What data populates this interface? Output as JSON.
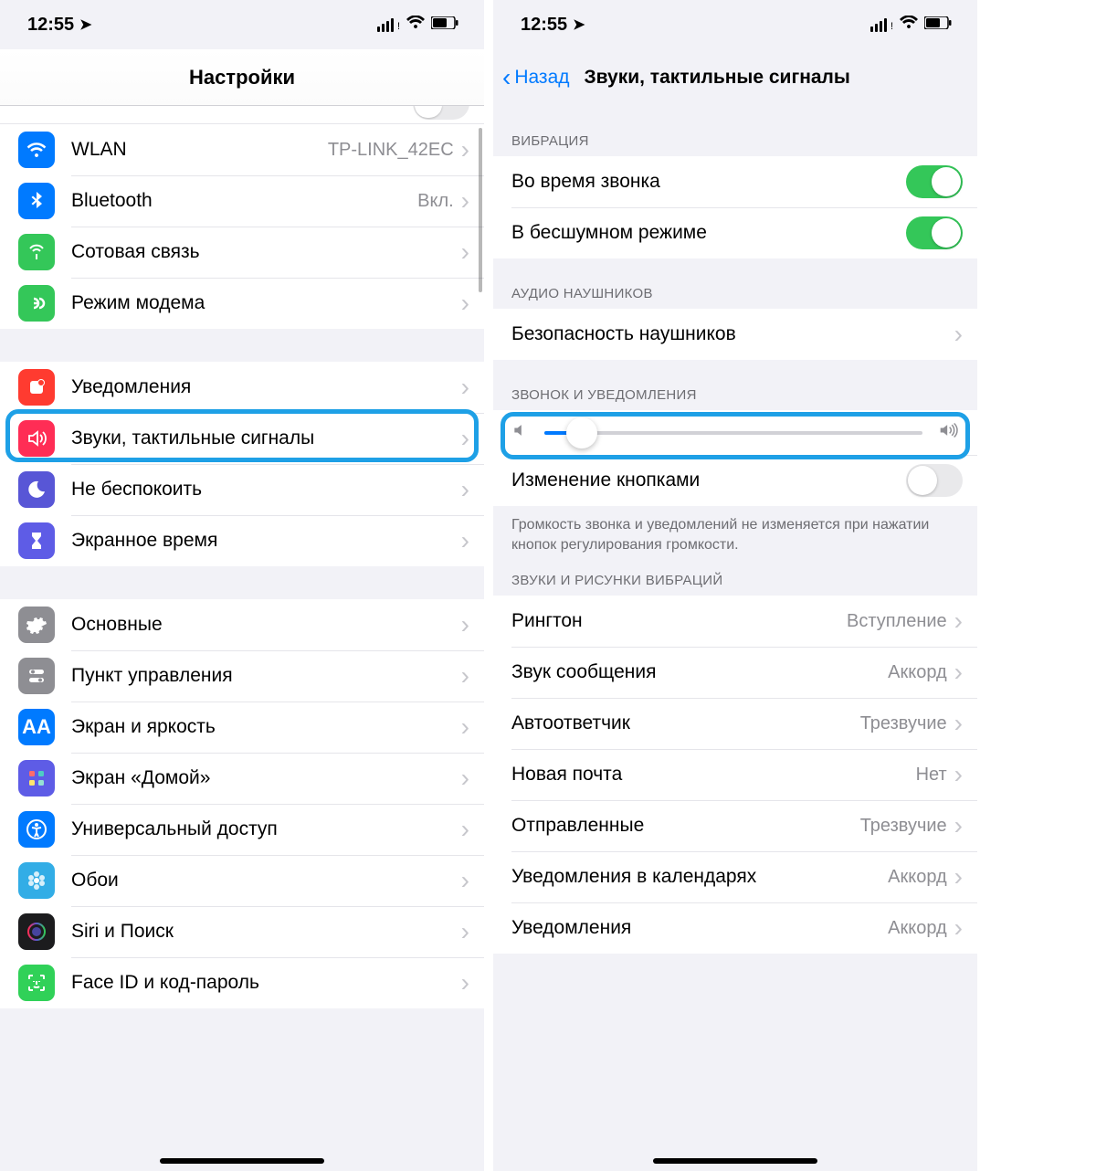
{
  "statusbar": {
    "time": "12:55"
  },
  "left": {
    "title": "Настройки",
    "rows": [
      {
        "id": "wlan",
        "label": "WLAN",
        "value": "TP-LINK_42EC",
        "icon": "wifi-icon",
        "bg": "bg-blue"
      },
      {
        "id": "bluetooth",
        "label": "Bluetooth",
        "value": "Вкл.",
        "icon": "bluetooth-icon",
        "bg": "bg-blue"
      },
      {
        "id": "cellular",
        "label": "Сотовая связь",
        "icon": "antenna-icon",
        "bg": "bg-green"
      },
      {
        "id": "hotspot",
        "label": "Режим модема",
        "icon": "link-icon",
        "bg": "bg-green"
      }
    ],
    "rows2": [
      {
        "id": "notifications",
        "label": "Уведомления",
        "icon": "bell-icon",
        "bg": "bg-red"
      },
      {
        "id": "sounds",
        "label": "Звуки, тактильные сигналы",
        "icon": "speaker-icon",
        "bg": "bg-pink",
        "highlighted": true
      },
      {
        "id": "dnd",
        "label": "Не беспокоить",
        "icon": "moon-icon",
        "bg": "bg-purple"
      },
      {
        "id": "screentime",
        "label": "Экранное время",
        "icon": "hourglass-icon",
        "bg": "bg-indigo"
      }
    ],
    "rows3": [
      {
        "id": "general",
        "label": "Основные",
        "icon": "gear-icon",
        "bg": "bg-gray"
      },
      {
        "id": "control-center",
        "label": "Пункт управления",
        "icon": "switches-icon",
        "bg": "bg-gray"
      },
      {
        "id": "display",
        "label": "Экран и яркость",
        "icon": "text-size-icon",
        "bg": "bg-blue"
      },
      {
        "id": "home",
        "label": "Экран «Домой»",
        "icon": "grid-icon",
        "bg": "bg-indigo"
      },
      {
        "id": "accessibility",
        "label": "Универсальный доступ",
        "icon": "accessibility-icon",
        "bg": "bg-blue"
      },
      {
        "id": "wallpaper",
        "label": "Обои",
        "icon": "flower-icon",
        "bg": "bg-cyan"
      },
      {
        "id": "siri",
        "label": "Siri и Поиск",
        "icon": "siri-icon",
        "bg": "bg-black"
      },
      {
        "id": "faceid",
        "label": "Face ID и код-пароль",
        "icon": "face-icon",
        "bg": "bg-lime"
      }
    ]
  },
  "right": {
    "back_label": "Назад",
    "title": "Звуки, тактильные сигналы",
    "sections": {
      "vibration": {
        "header": "ВИБРАЦИЯ",
        "rows": [
          {
            "id": "vibrate-ring",
            "label": "Во время звонка",
            "toggle": "on"
          },
          {
            "id": "vibrate-silent",
            "label": "В бесшумном режиме",
            "toggle": "on"
          }
        ]
      },
      "headphone": {
        "header": "АУДИО НАУШНИКОВ",
        "rows": [
          {
            "id": "headphone-safety",
            "label": "Безопасность наушников",
            "chevron": true
          }
        ]
      },
      "ringer": {
        "header": "ЗВОНОК И УВЕДОМЛЕНИЯ",
        "slider_percent": 10,
        "change_buttons": {
          "label": "Изменение кнопками",
          "toggle": "off"
        },
        "footer": "Громкость звонка и уведомлений не изменяется при нажатии кнопок регулирования громкости."
      },
      "patterns": {
        "header": "ЗВУКИ И РИСУНКИ ВИБРАЦИЙ",
        "rows": [
          {
            "id": "ringtone",
            "label": "Рингтон",
            "value": "Вступление"
          },
          {
            "id": "text-tone",
            "label": "Звук сообщения",
            "value": "Аккорд"
          },
          {
            "id": "voicemail",
            "label": "Автоответчик",
            "value": "Трезвучие"
          },
          {
            "id": "new-mail",
            "label": "Новая почта",
            "value": "Нет"
          },
          {
            "id": "sent-mail",
            "label": "Отправленные",
            "value": "Трезвучие"
          },
          {
            "id": "calendar",
            "label": "Уведомления в календарях",
            "value": "Аккорд"
          },
          {
            "id": "reminders",
            "label": "Уведомления",
            "value": "Аккорд"
          }
        ]
      }
    }
  }
}
